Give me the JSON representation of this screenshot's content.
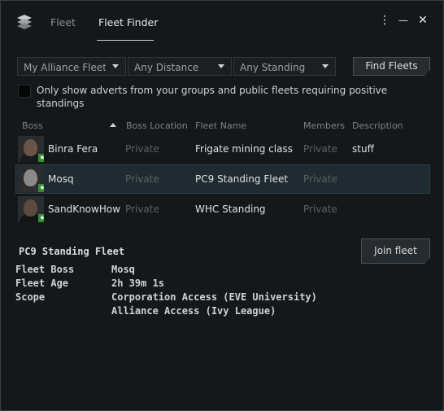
{
  "header": {
    "tabs": [
      {
        "label": "Fleet"
      },
      {
        "label": "Fleet Finder"
      }
    ],
    "kebab_glyph": "⋮",
    "minimize_glyph": "—",
    "close_glyph": "✕"
  },
  "filters": {
    "alliance": "My Alliance Fleet",
    "distance": "Any Distance",
    "standing": "Any Standing",
    "find_label": "Find Fleets"
  },
  "checkbox": {
    "label": "Only show adverts from your groups and public fleets requiring positive standings",
    "checked": false
  },
  "table": {
    "columns": [
      "Boss",
      "Boss Location",
      "Fleet Name",
      "Members",
      "Description"
    ],
    "rows": [
      {
        "boss": "Binra Fera",
        "location": "Private",
        "fleet": "Frigate mining class",
        "members": "Private",
        "description": "stuff",
        "selected": false
      },
      {
        "boss": "Mosq",
        "location": "Private",
        "fleet": "PC9 Standing Fleet",
        "members": "Private",
        "description": "",
        "selected": true
      },
      {
        "boss": "SandKnowHow",
        "location": "Private",
        "fleet": "WHC Standing",
        "members": "Private",
        "description": "",
        "selected": false
      }
    ],
    "badge_glyph": "★"
  },
  "details": {
    "title": "PC9 Standing Fleet",
    "join_label": "Join fleet",
    "fields": [
      {
        "label": "Fleet Boss",
        "value": "Mosq"
      },
      {
        "label": "Fleet Age",
        "value": "2h 39m 1s"
      },
      {
        "label": "Scope",
        "value": "Corporation Access (EVE University)"
      },
      {
        "label": "",
        "value": "Alliance Access (Ivy League)"
      }
    ]
  },
  "colors": {
    "background": "#15181a",
    "selected_row": "#1f2a31",
    "badge": "#2f8f2f"
  }
}
